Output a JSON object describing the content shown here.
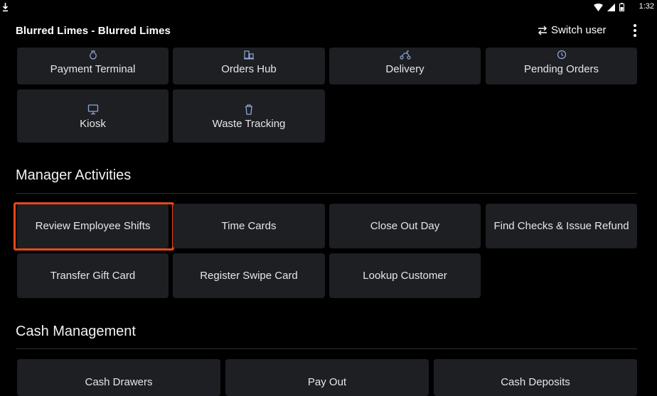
{
  "status_bar": {
    "time": "1:32"
  },
  "app_bar": {
    "title": "Blurred Limes - Blurred Limes",
    "switch_user_label": "Switch user"
  },
  "top_tiles": [
    {
      "label": "Payment Terminal",
      "icon": "money-bag-icon"
    },
    {
      "label": "Orders Hub",
      "icon": "orders-hub-icon"
    },
    {
      "label": "Delivery",
      "icon": "scooter-icon"
    },
    {
      "label": "Pending Orders",
      "icon": "clock-icon"
    },
    {
      "label": "Kiosk",
      "icon": "monitor-icon"
    },
    {
      "label": "Waste Tracking",
      "icon": "trash-icon"
    }
  ],
  "manager_activities": {
    "title": "Manager Activities",
    "items": [
      {
        "label": "Review Employee Shifts"
      },
      {
        "label": "Time Cards"
      },
      {
        "label": "Close Out Day"
      },
      {
        "label": "Find Checks & Issue Refund"
      },
      {
        "label": "Transfer Gift Card"
      },
      {
        "label": "Register Swipe Card"
      },
      {
        "label": "Lookup Customer"
      }
    ]
  },
  "cash_management": {
    "title": "Cash Management",
    "items": [
      {
        "label": "Cash Drawers"
      },
      {
        "label": "Pay Out"
      },
      {
        "label": "Cash Deposits"
      }
    ]
  },
  "colors": {
    "background": "#000000",
    "tile": "#1e1f23",
    "icon_accent": "#8fa8d8",
    "highlight": "#e8471d"
  }
}
